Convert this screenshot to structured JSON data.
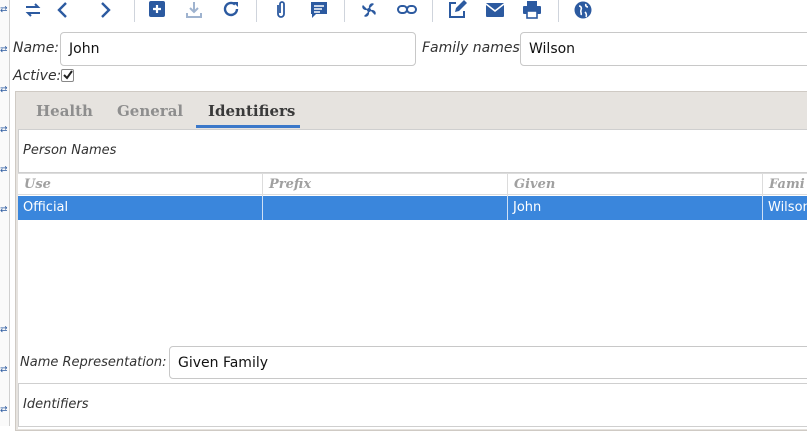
{
  "toolbar": {
    "buttons": [
      {
        "name": "switch-view-icon"
      },
      {
        "name": "previous-record-icon"
      },
      {
        "name": "next-record-icon"
      },
      {
        "name": "new-record-icon"
      },
      {
        "name": "save-icon"
      },
      {
        "name": "reload-icon"
      },
      {
        "name": "attachment-icon"
      },
      {
        "name": "note-icon"
      },
      {
        "name": "action-icon"
      },
      {
        "name": "relate-icon"
      },
      {
        "name": "edit-report-icon"
      },
      {
        "name": "email-icon"
      },
      {
        "name": "print-icon"
      },
      {
        "name": "globe-icon"
      }
    ]
  },
  "form": {
    "name_label": "Name:",
    "name_value": "John",
    "family_label": "Family names:",
    "family_value": "Wilson",
    "active_label": "Active:",
    "active_checked": true
  },
  "tabs": [
    {
      "label": "Health",
      "active": false
    },
    {
      "label": "General",
      "active": false
    },
    {
      "label": "Identifiers",
      "active": true
    }
  ],
  "person_names": {
    "title": "Person Names",
    "columns": [
      "Use",
      "Prefix",
      "Given",
      "Fami"
    ],
    "rows": [
      {
        "use": "Official",
        "prefix": "",
        "given": "John",
        "family": "Wilson",
        "selected": true
      }
    ]
  },
  "name_representation": {
    "label": "Name Representation:",
    "value": "Given Family"
  },
  "identifiers": {
    "title": "Identifiers"
  },
  "colors": {
    "accent": "#2c5aa0",
    "selection": "#3a86dc",
    "tab_underline": "#3b78c9"
  }
}
